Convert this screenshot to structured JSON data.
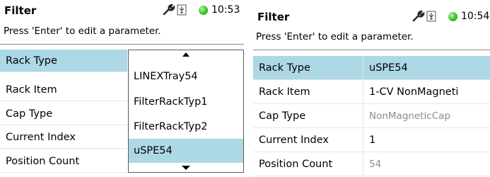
{
  "colors": {
    "selection": "#add8e6",
    "led": "#3dc12a",
    "muted_text": "#8c8c8c"
  },
  "left": {
    "title": "Filter",
    "time": "10:53",
    "hint": "Press 'Enter' to edit a parameter.",
    "rows": [
      {
        "label": "Rack Type",
        "selected": true
      },
      {
        "label": "Rack Item"
      },
      {
        "label": "Cap Type"
      },
      {
        "label": "Current Index"
      },
      {
        "label": "Position Count"
      }
    ],
    "dropdown": {
      "options": [
        "LINEXTray54",
        "FilterRackTyp1",
        "FilterRackTyp2",
        "uSPE54"
      ],
      "selected": "uSPE54"
    }
  },
  "right": {
    "title": "Filter",
    "time": "10:54",
    "hint": "Press 'Enter' to edit a parameter.",
    "rows": [
      {
        "label": "Rack Type",
        "value": "uSPE54",
        "selected": true
      },
      {
        "label": "Rack Item",
        "value": "1-CV NonMagneti"
      },
      {
        "label": "Cap Type",
        "value": "NonMagneticCap",
        "muted": true
      },
      {
        "label": "Current Index",
        "value": "1"
      },
      {
        "label": "Position Count",
        "value": "54",
        "muted": true
      }
    ]
  },
  "icons": [
    "wrench-icon",
    "usb-icon",
    "status-led-icon",
    "scroll-up-icon",
    "scroll-down-icon"
  ]
}
